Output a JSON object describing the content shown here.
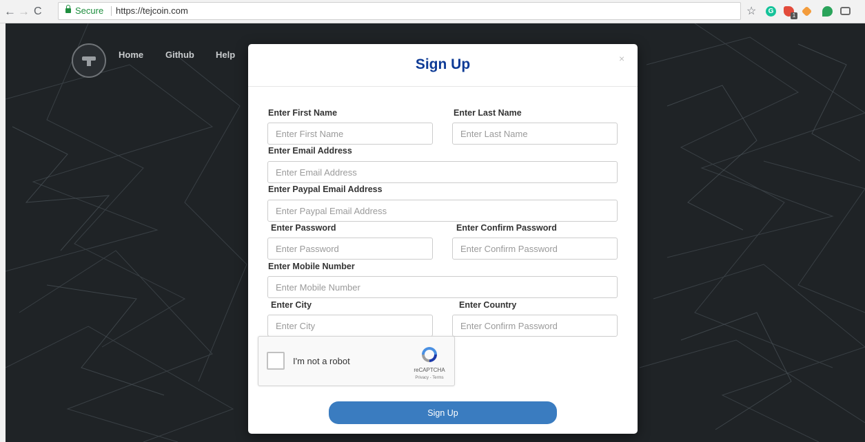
{
  "browser": {
    "secure_label": "Secure",
    "url": "https://tejcoin.com",
    "extensions": [
      "grammarly-icon",
      "red-extension-icon",
      "fox-extension-icon",
      "green-extension-icon",
      "camera-icon"
    ],
    "extension_badge": "1",
    "grammarly_glyph": "G"
  },
  "site": {
    "nav": [
      {
        "label": "Home"
      },
      {
        "label": "Github"
      },
      {
        "label": "Help"
      }
    ]
  },
  "modal": {
    "title": "Sign Up",
    "close": "×",
    "fields": {
      "first_name": {
        "label": "Enter First Name",
        "placeholder": "Enter First Name"
      },
      "last_name": {
        "label": "Enter Last Name",
        "placeholder": "Enter Last Name"
      },
      "email": {
        "label": "Enter Email Address",
        "placeholder": "Enter Email Address"
      },
      "paypal": {
        "label": "Enter Paypal Email Address",
        "placeholder": "Enter Paypal Email Address"
      },
      "password": {
        "label": "Enter Password",
        "placeholder": "Enter Password"
      },
      "confirm_password": {
        "label": "Enter Confirm Password",
        "placeholder": "Enter Confirm Password"
      },
      "mobile": {
        "label": "Enter Mobile Number",
        "placeholder": "Enter Mobile Number"
      },
      "city": {
        "label": "Enter City",
        "placeholder": "Enter City"
      },
      "country": {
        "label": "Enter Country",
        "placeholder": "Enter Confirm Password"
      }
    },
    "captcha": {
      "label": "I'm not a robot",
      "brand": "reCAPTCHA",
      "terms": "Privacy - Terms"
    },
    "submit_label": "Sign Up"
  },
  "colors": {
    "title": "#0e3b96",
    "submit": "#3a7cc0",
    "page_bg": "#1f2326"
  }
}
